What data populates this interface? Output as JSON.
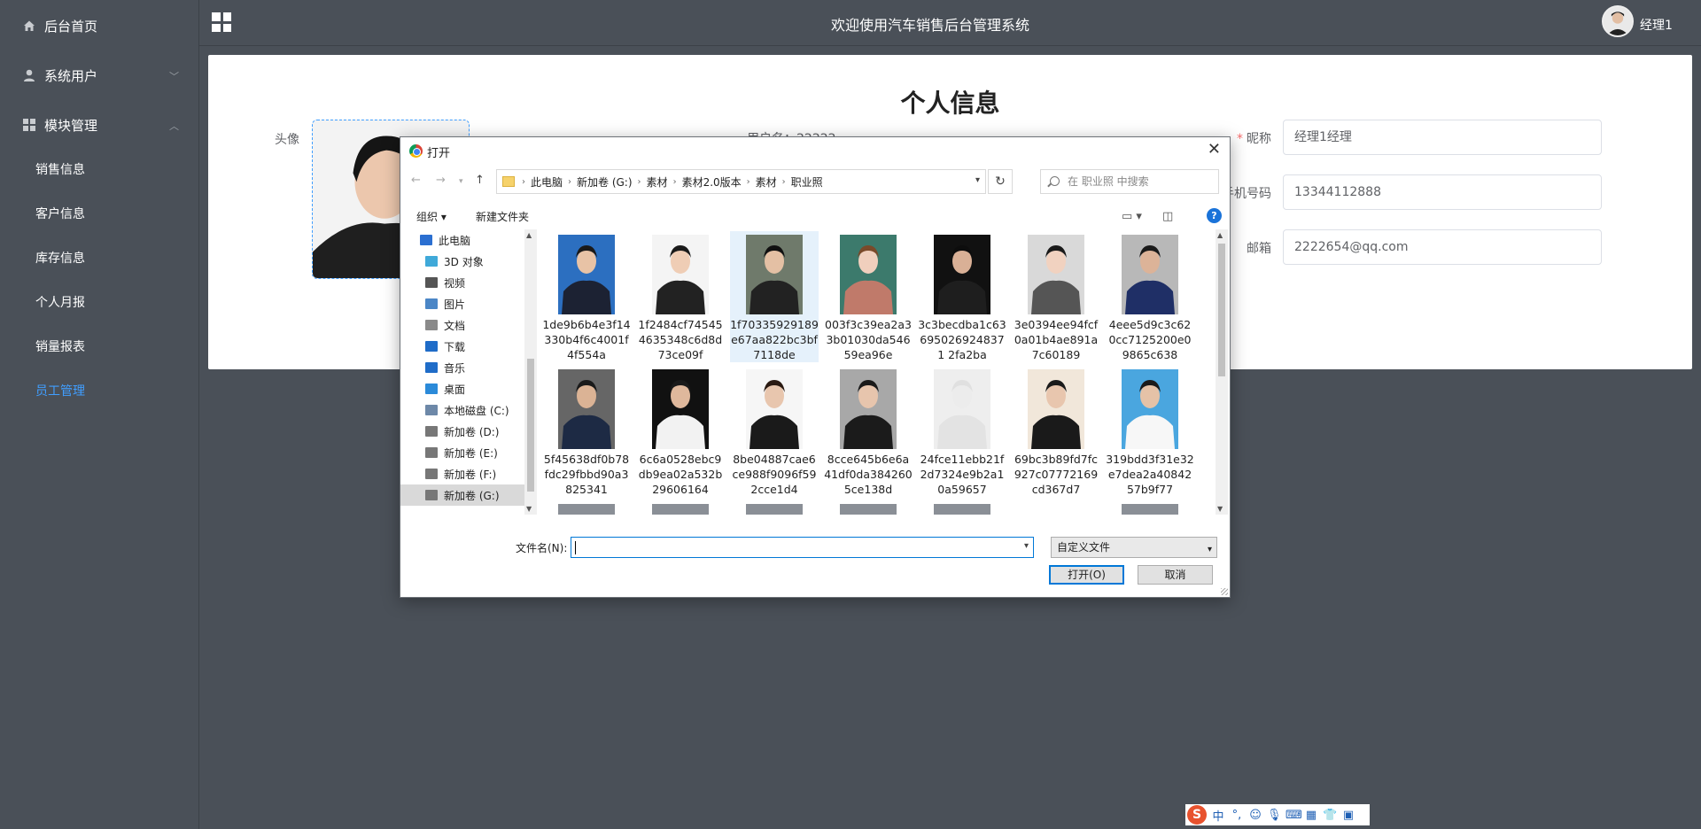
{
  "sidebar": {
    "home": "后台首页",
    "system_users": "系统用户",
    "module_mgmt": "模块管理",
    "sub_items": [
      "销售信息",
      "客户信息",
      "库存信息",
      "个人月报",
      "销量报表",
      "员工管理"
    ],
    "active_index": 5
  },
  "header": {
    "title": "欢迎使用汽车销售后台管理系统",
    "username": "经理1"
  },
  "profile": {
    "title": "个人信息",
    "avatar_label": "头像",
    "username_label": "用户名：22222",
    "nickname_label": "昵称",
    "nickname_value": "经理1经理",
    "phone_label": "手机号码",
    "phone_value": "13344112888",
    "email_label": "邮箱",
    "email_value": "2222654@qq.com"
  },
  "dialog": {
    "title": "打开",
    "breadcrumbs": [
      "此电脑",
      "新加卷 (G:)",
      "素材",
      "素材2.0版本",
      "素材",
      "职业照"
    ],
    "search_placeholder": "在 职业照 中搜索",
    "organize": "组织 ▾",
    "new_folder": "新建文件夹",
    "tree": [
      {
        "label": "此电脑",
        "color": "#2b6fd1",
        "level": 0
      },
      {
        "label": "3D 对象",
        "color": "#3fa9d9",
        "level": 1
      },
      {
        "label": "视频",
        "color": "#555555",
        "level": 1
      },
      {
        "label": "图片",
        "color": "#4b86c6",
        "level": 1
      },
      {
        "label": "文档",
        "color": "#8a8a8a",
        "level": 1
      },
      {
        "label": "下载",
        "color": "#1f6cc8",
        "level": 1
      },
      {
        "label": "音乐",
        "color": "#1f6cc8",
        "level": 1
      },
      {
        "label": "桌面",
        "color": "#2b8ad9",
        "level": 1
      },
      {
        "label": "本地磁盘 (C:)",
        "color": "#6d88a8",
        "level": 1
      },
      {
        "label": "新加卷 (D:)",
        "color": "#777777",
        "level": 1
      },
      {
        "label": "新加卷 (E:)",
        "color": "#777777",
        "level": 1
      },
      {
        "label": "新加卷 (F:)",
        "color": "#777777",
        "level": 1
      },
      {
        "label": "新加卷 (G:)",
        "color": "#777777",
        "level": 1,
        "selected": true
      }
    ],
    "files": [
      {
        "name": "1de9b6b4e3f14330b4f6c4001f4f554a",
        "bg": "#2c6fc0",
        "suit": "#1c2233",
        "skin": "#e8c3a6",
        "hair": "#1a1a1a"
      },
      {
        "name": "1f2484cf745454635348c6d8d73ce09f",
        "bg": "#f4f4f4",
        "suit": "#222222",
        "skin": "#efcdb5",
        "hair": "#1a1a1a"
      },
      {
        "name": "1f70335929189e67aa822bc3bf7118de",
        "bg": "#6f7a6b",
        "suit": "#222222",
        "skin": "#e4c0a4",
        "hair": "#111111",
        "selected": true
      },
      {
        "name": "003f3c39ea2a33b01030da54659ea96e",
        "bg": "#3c7a6c",
        "suit": "#c07a6a",
        "skin": "#f0cfbd",
        "hair": "#7a4a2a"
      },
      {
        "name": "3c3becdba1c636950269248371 2fa2ba",
        "bg": "#111111",
        "suit": "#1e1e1e",
        "skin": "#d9b096",
        "hair": "#0d0d0d"
      },
      {
        "name": "3e0394ee94fcf0a01b4ae891a7c60189",
        "bg": "#d9d9d9",
        "suit": "#555555",
        "skin": "#f1d2c0",
        "hair": "#1a1a1a"
      },
      {
        "name": "4eee5d9c3c620cc7125200e09865c638",
        "bg": "#b8b8b8",
        "suit": "#1f2f66",
        "skin": "#dcb398",
        "hair": "#1a1a1a"
      },
      {
        "name": "5f45638df0b78fdc29fbbd90a3825341",
        "bg": "#666666",
        "suit": "#1d2a44",
        "skin": "#dbb395",
        "hair": "#1a1a1a"
      },
      {
        "name": "6c6a0528ebc9db9ea02a532b29606164",
        "bg": "#111111",
        "suit": "#f2f2f2",
        "skin": "#dfb89c",
        "hair": "#1a1a1a"
      },
      {
        "name": "8be04887cae6ce988f9096f592cce1d4",
        "bg": "#f6f6f6",
        "suit": "#1a1a1a",
        "skin": "#e8c6ae",
        "hair": "#2a1a12"
      },
      {
        "name": "8cce645b6e6a41df0da3842605ce138d",
        "bg": "#a8a8a8",
        "suit": "#1b1b1b",
        "skin": "#e7c5ad",
        "hair": "#1a1a1a"
      },
      {
        "name": "24fce11ebb21f2d7324e9b2a10a59657",
        "bg": "#eeeeee",
        "suit": "#e3e3e3",
        "skin": "#ececec",
        "hair": "#e0e0e0"
      },
      {
        "name": "69bc3b89fd7fc927c07772169cd367d7",
        "bg": "#f1e7da",
        "suit": "#1a1a1a",
        "skin": "#e8c6ae",
        "hair": "#1a1a1a"
      },
      {
        "name": "319bdd3f31e32e7dea2a4084257b9f77",
        "bg": "#4aa6df",
        "suit": "#f7f7f7",
        "skin": "#e5c2a7",
        "hair": "#1a1a1a"
      }
    ],
    "filename_label": "文件名(N):",
    "filename_value": "",
    "filter": "自定义文件",
    "open_btn": "打开(O)",
    "cancel_btn": "取消"
  },
  "ime": {
    "logo": "S",
    "lang": "中"
  }
}
